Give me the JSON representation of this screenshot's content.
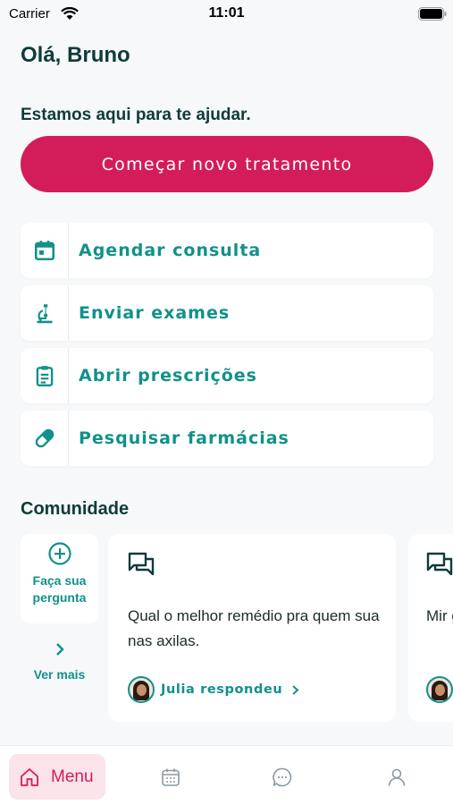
{
  "status_bar": {
    "carrier": "Carrier",
    "time": "11:01"
  },
  "header": {
    "greeting": "Olá, Bruno",
    "helper": "Estamos aqui para te ajudar.",
    "primary_cta": "Começar novo tratamento"
  },
  "actions": [
    {
      "label": "Agendar consulta",
      "icon": "calendar-icon"
    },
    {
      "label": "Enviar exames",
      "icon": "microscope-icon"
    },
    {
      "label": "Abrir prescrições",
      "icon": "clipboard-icon"
    },
    {
      "label": "Pesquisar farmácias",
      "icon": "pill-icon"
    }
  ],
  "community": {
    "title": "Comunidade",
    "ask_label": "Faça sua pergunta",
    "see_more": "Ver mais",
    "posts": [
      {
        "question": "Qual o melhor remédio pra quem sua nas axilas.",
        "answer": "Julia respondeu"
      },
      {
        "question": "Mir gra cal",
        "answer": ""
      }
    ]
  },
  "tab_bar": {
    "menu_label": "Menu",
    "tabs": [
      "home-icon",
      "calendar-icon",
      "chat-icon",
      "profile-icon"
    ]
  },
  "colors": {
    "primary": "#d31c5a",
    "accent": "#11918a",
    "text": "#0f3b39"
  }
}
